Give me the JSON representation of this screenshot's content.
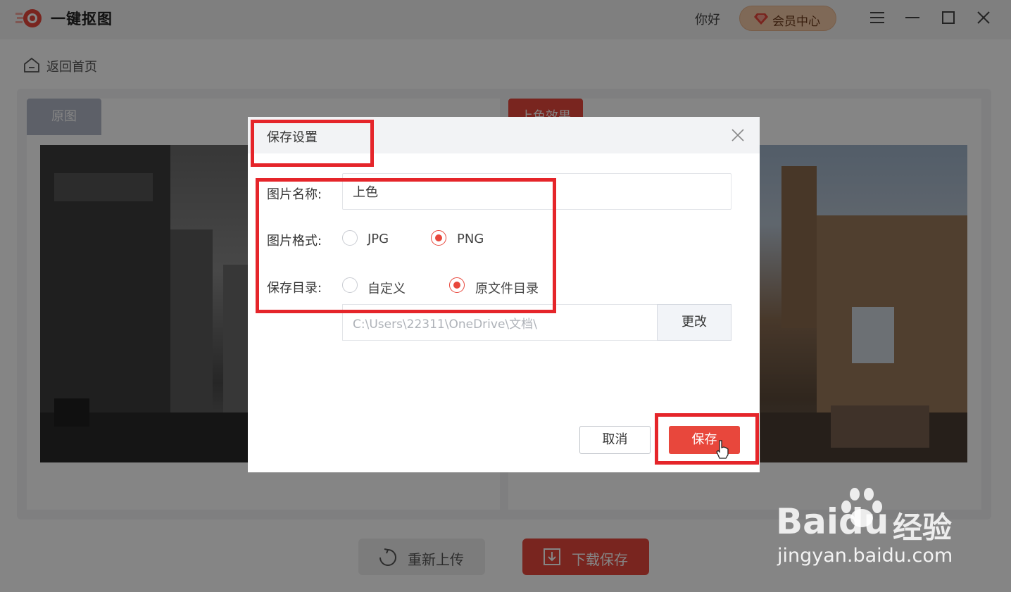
{
  "app": {
    "title": "一键抠图",
    "greeting": "你好",
    "vip_label": "会员中心",
    "accent_color": "#e8473c"
  },
  "nav": {
    "back_label": "返回首页"
  },
  "preview": {
    "tab_original": "原图",
    "tab_colorized": "上色效果"
  },
  "actions": {
    "reupload_label": "重新上传",
    "download_label": "下载保存"
  },
  "dialog": {
    "title": "保存设置",
    "name_label": "图片名称:",
    "name_value": "上色",
    "format_label": "图片格式:",
    "format_options": [
      "JPG",
      "PNG"
    ],
    "format_selected": "PNG",
    "dir_label": "保存目录:",
    "dir_options": [
      "自定义",
      "原文件目录"
    ],
    "dir_selected": "原文件目录",
    "path_value": "C:\\Users\\22311\\OneDrive\\文档\\",
    "change_label": "更改",
    "cancel_label": "取消",
    "save_label": "保存"
  },
  "watermark": {
    "logo": "Baidu",
    "logo_cn": "经验",
    "url": "jingyan.baidu.com"
  }
}
